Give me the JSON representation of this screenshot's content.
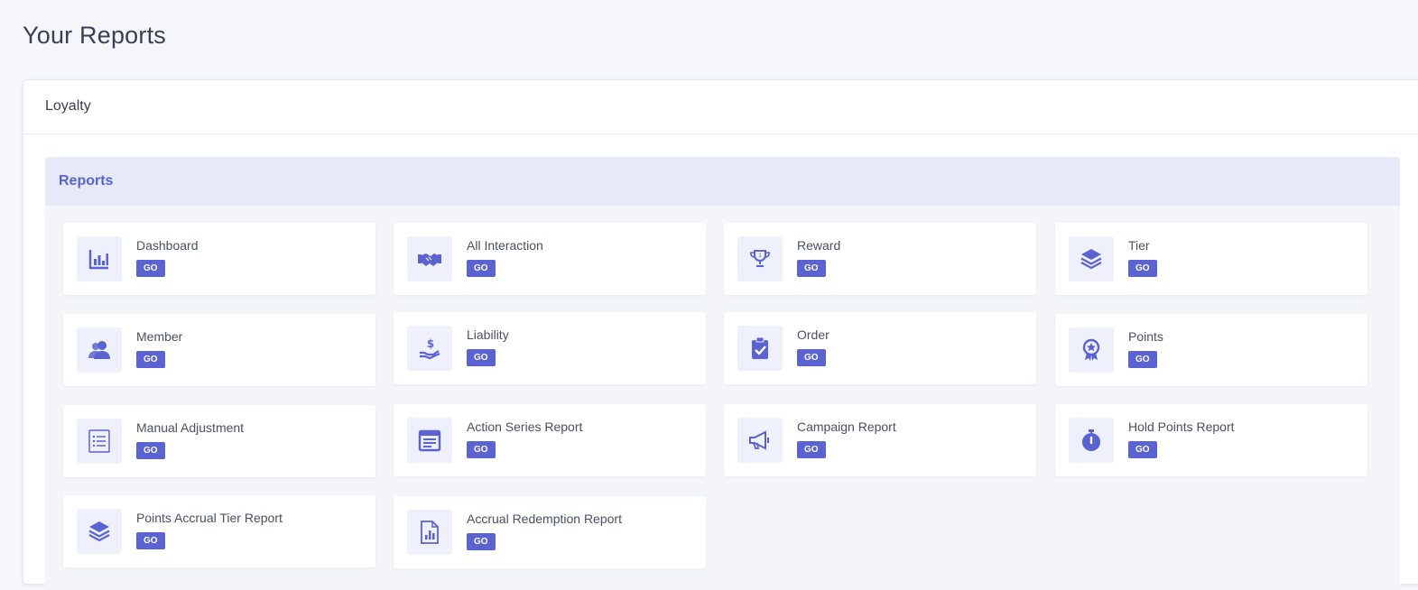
{
  "page": {
    "title": "Your Reports"
  },
  "card": {
    "header": "Loyalty"
  },
  "section": {
    "title": "Reports"
  },
  "tiles": [
    {
      "label": "Dashboard",
      "go": "GO",
      "icon": "bar-chart-icon"
    },
    {
      "label": "All Interaction",
      "go": "GO",
      "icon": "handshake-icon"
    },
    {
      "label": "Reward",
      "go": "GO",
      "icon": "trophy-icon"
    },
    {
      "label": "Tier",
      "go": "GO",
      "icon": "layers-icon"
    },
    {
      "label": "Member",
      "go": "GO",
      "icon": "users-icon"
    },
    {
      "label": "Liability",
      "go": "GO",
      "icon": "hand-dollar-icon"
    },
    {
      "label": "Order",
      "go": "GO",
      "icon": "clipboard-check-icon"
    },
    {
      "label": "Points",
      "go": "GO",
      "icon": "award-badge-icon"
    },
    {
      "label": "Manual Adjustment",
      "go": "GO",
      "icon": "list-icon"
    },
    {
      "label": "Action Series Report",
      "go": "GO",
      "icon": "calendar-icon"
    },
    {
      "label": "Campaign Report",
      "go": "GO",
      "icon": "megaphone-icon"
    },
    {
      "label": "Hold Points Report",
      "go": "GO",
      "icon": "stopwatch-icon"
    },
    {
      "label": "Points Accrual Tier Report",
      "go": "GO",
      "icon": "layers-icon"
    },
    {
      "label": "Accrual Redemption Report",
      "go": "GO",
      "icon": "file-chart-icon"
    }
  ],
  "colors": {
    "accent": "#5b63d3",
    "section_header_bg": "#e6e9f7",
    "icon_bg": "#eef0fb",
    "page_bg": "#f5f6fa"
  }
}
